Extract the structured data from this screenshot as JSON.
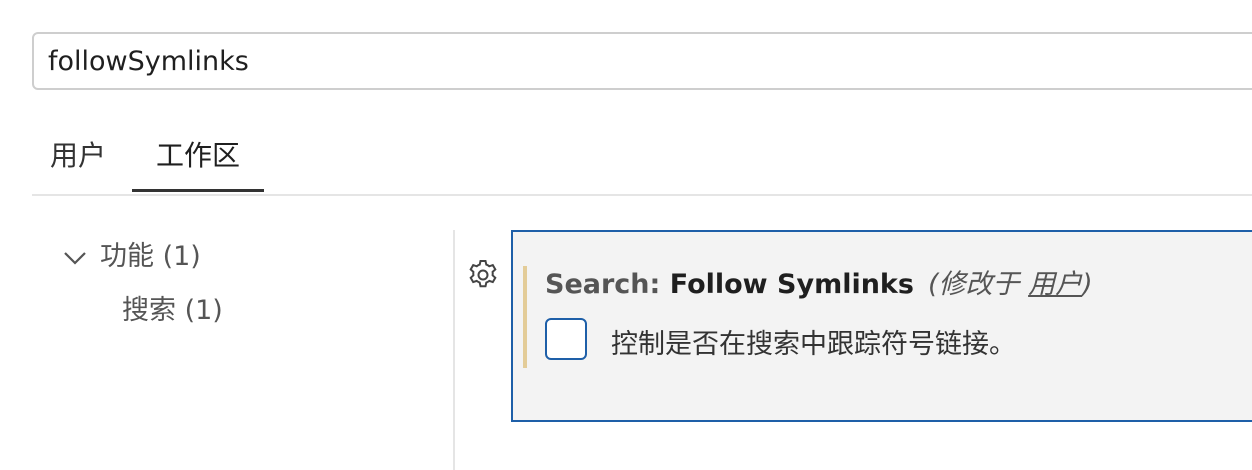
{
  "search": {
    "value": "followSymlinks"
  },
  "tabs": [
    {
      "label": "用户",
      "active": false
    },
    {
      "label": "工作区",
      "active": true
    }
  ],
  "toc": {
    "features": "功能 (1)",
    "search": "搜索 (1)"
  },
  "setting": {
    "category": "Search: ",
    "name": "Follow Symlinks",
    "modified_prefix": "(修改于 ",
    "modified_link": "用户",
    "modified_suffix": ")",
    "description": "控制是否在搜索中跟踪符号链接。",
    "checked": false
  },
  "colors": {
    "focus_border": "#1e5fa8",
    "modified_indicator": "#e3cc98",
    "item_background": "#f3f3f3"
  },
  "icons": {
    "gear": "gear-icon",
    "chevron": "chevron-down-icon"
  }
}
